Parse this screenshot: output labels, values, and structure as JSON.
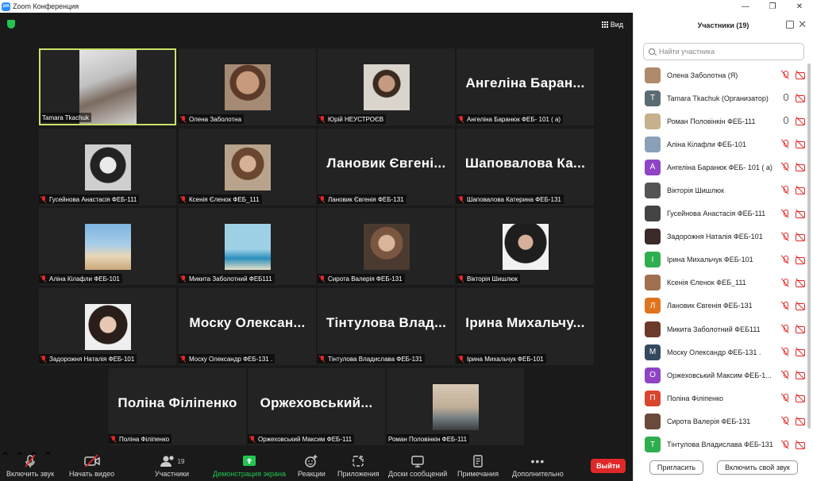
{
  "window": {
    "title": "Zoom Конференция",
    "logo": "zm"
  },
  "view_label": "Вид",
  "tiles": [
    {
      "name": "Tamara Tkachuk",
      "big": "",
      "photo": "p1",
      "muted": false
    },
    {
      "name": "Олена Заболотна",
      "big": "",
      "photo": "p2",
      "muted": true
    },
    {
      "name": "Юрій НЕУСТРОЄВ",
      "big": "",
      "photo": "p3",
      "muted": true
    },
    {
      "name": "Ангеліна Баранюк ФЕБ- 101 ( а)",
      "big": "Ангеліна Баран...",
      "photo": "",
      "muted": true
    },
    {
      "name": "Гусейнова Анастасія ФЕБ-111",
      "big": "",
      "photo": "p4",
      "muted": true
    },
    {
      "name": "Ксенія Єленок ФЕБ_111",
      "big": "",
      "photo": "p5",
      "muted": true
    },
    {
      "name": "Лановик Євгенія ФЕБ-131",
      "big": "Лановик Євгені...",
      "photo": "",
      "muted": true
    },
    {
      "name": "Шаповалова Катерина ФЕБ-131",
      "big": "Шаповалова Ка...",
      "photo": "",
      "muted": true
    },
    {
      "name": "Аліна Кілафли ФЕБ-101",
      "big": "",
      "photo": "p6",
      "muted": true
    },
    {
      "name": "Микита Заболотний ФЕБ111",
      "big": "",
      "photo": "p7",
      "muted": true
    },
    {
      "name": "Сирота Валерія ФЕБ-131",
      "big": "",
      "photo": "p8",
      "muted": true
    },
    {
      "name": "Вікторія Шишлюк",
      "big": "",
      "photo": "p9",
      "muted": true
    },
    {
      "name": "Задорожня Наталія ФЕБ-101",
      "big": "",
      "photo": "p10",
      "muted": true
    },
    {
      "name": "Моску Олександр ФЕБ-131 .",
      "big": "Моску Олексан...",
      "photo": "",
      "muted": true
    },
    {
      "name": "Тінтулова Владислава ФЕБ-131",
      "big": "Тінтулова Влад...",
      "photo": "",
      "muted": true
    },
    {
      "name": "Ірина Михальчук ФЕБ-101",
      "big": "Ірина Михальчу...",
      "photo": "",
      "muted": true
    },
    {
      "name": "Поліна Філіпенко",
      "big": "Поліна Філіпенко",
      "photo": "",
      "muted": true
    },
    {
      "name": "Оржеховський Максим ФЕБ-111",
      "big": "Оржеховський...",
      "photo": "",
      "muted": true
    },
    {
      "name": "Роман Половінкін ФЕБ-111",
      "big": "",
      "photo": "p11",
      "muted": false
    }
  ],
  "toolbar": {
    "audio": "Включить звук",
    "video": "Начать видео",
    "participants": "Участники",
    "participants_count": "19",
    "share": "Демонстрация экрана",
    "reactions": "Реакции",
    "apps": "Приложения",
    "whiteboards": "Доски сообщений",
    "notes": "Примечания",
    "more": "Дополнительно",
    "leave": "Выйти"
  },
  "panel": {
    "title": "Участники (19)",
    "search_placeholder": "Найти участника",
    "invite": "Пригласить",
    "unmute_me": "Включить свой звук",
    "participants": [
      {
        "name": "Олена Заболотна (Я)",
        "avatar": "",
        "color": "#b08a6a",
        "mic": "off",
        "video": "off"
      },
      {
        "name": "Tamara Tkachuk (Организатор)",
        "avatar": "T",
        "color": "#5a6b73",
        "mic": "on",
        "video": "off"
      },
      {
        "name": "Роман Половінкін ФЕБ-111",
        "avatar": "",
        "color": "#c7b08c",
        "mic": "on",
        "video": "off"
      },
      {
        "name": "Аліна Кілафли ФЕБ-101",
        "avatar": "",
        "color": "#8aa0b8",
        "mic": "off",
        "video": "off"
      },
      {
        "name": "Ангеліна Баранюк ФЕБ- 101 ( а)",
        "avatar": "А",
        "color": "#8e44c5",
        "mic": "off",
        "video": "off"
      },
      {
        "name": "Вікторія Шишлюк",
        "avatar": "",
        "color": "#555",
        "mic": "off",
        "video": "off"
      },
      {
        "name": "Гусейнова Анастасія ФЕБ-111",
        "avatar": "",
        "color": "#444",
        "mic": "off",
        "video": "off"
      },
      {
        "name": "Задорожня Наталія ФЕБ-101",
        "avatar": "",
        "color": "#3a2a28",
        "mic": "off",
        "video": "off"
      },
      {
        "name": "Ірина Михальчук ФЕБ-101",
        "avatar": "І",
        "color": "#2eae4e",
        "mic": "off",
        "video": "off"
      },
      {
        "name": "Ксенія Єленок ФЕБ_111",
        "avatar": "",
        "color": "#a07050",
        "mic": "off",
        "video": "off"
      },
      {
        "name": "Лановик Євгенія ФЕБ-131",
        "avatar": "Л",
        "color": "#e0741e",
        "mic": "off",
        "video": "off"
      },
      {
        "name": "Микита Заболотний ФЕБ111",
        "avatar": "",
        "color": "#6b3a2a",
        "mic": "off",
        "video": "off"
      },
      {
        "name": "Моску Олександр ФЕБ-131 .",
        "avatar": "М",
        "color": "#34495e",
        "mic": "off",
        "video": "off"
      },
      {
        "name": "Оржеховський Максим ФЕБ-1...",
        "avatar": "О",
        "color": "#8e44c5",
        "mic": "off",
        "video": "off"
      },
      {
        "name": "Поліна Філіпенко",
        "avatar": "П",
        "color": "#d9452e",
        "mic": "off",
        "video": "off"
      },
      {
        "name": "Сирота Валерія ФЕБ-131",
        "avatar": "",
        "color": "#6a4a3a",
        "mic": "off",
        "video": "off"
      },
      {
        "name": "Тінтулова Владислава ФЕБ-131",
        "avatar": "Т",
        "color": "#2eae4e",
        "mic": "off",
        "video": "off"
      }
    ]
  }
}
